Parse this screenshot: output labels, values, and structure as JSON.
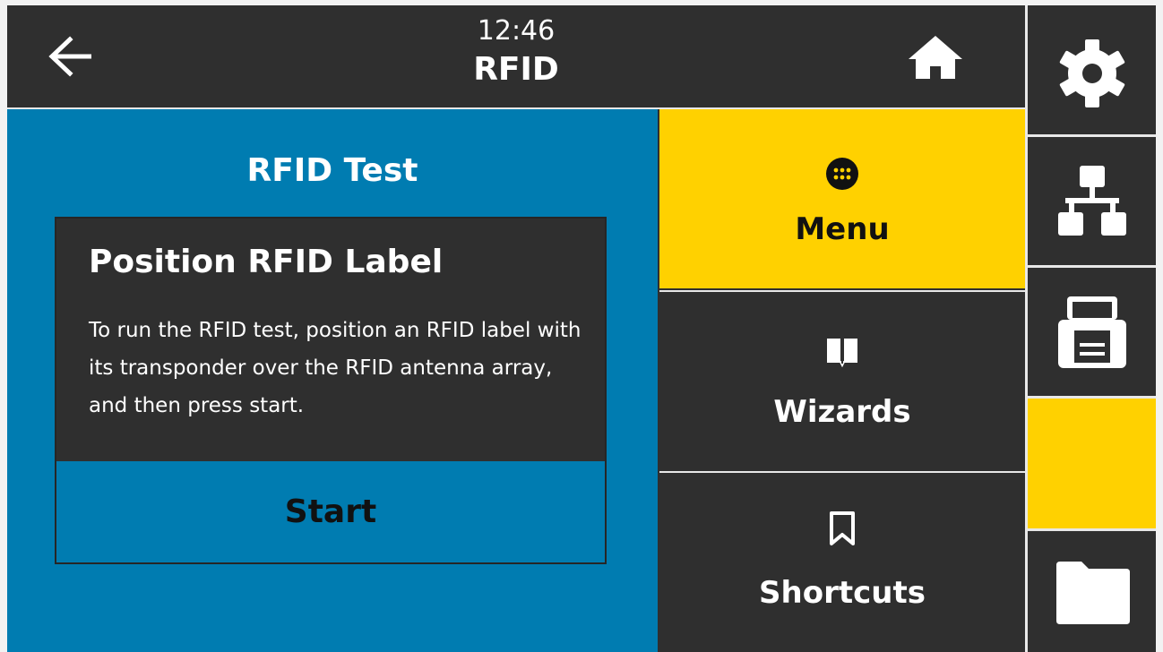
{
  "header": {
    "time": "12:46",
    "title": "RFID",
    "back_icon": "arrow-left-icon",
    "home_icon": "home-icon"
  },
  "main": {
    "title": "RFID Test",
    "dialog": {
      "heading": "Position RFID Label",
      "text": "To run the RFID test, position an RFID label with its transponder over the RFID antenna array, and then press start.",
      "start_label": "Start"
    }
  },
  "nav": {
    "menu": {
      "label": "Menu",
      "icon": "grid-dots-icon",
      "active": true
    },
    "wizards": {
      "label": "Wizards",
      "icon": "book-icon"
    },
    "shortcuts": {
      "label": "Shortcuts",
      "icon": "bookmark-icon"
    }
  },
  "rail": {
    "settings_icon": "gear-icon",
    "network_icon": "network-icon",
    "printer_icon": "printer-icon",
    "folder_icon": "folder-icon"
  },
  "colors": {
    "accent_yellow": "#ffd100",
    "panel_blue": "#007cb1",
    "dark_bg": "#2f2f2f"
  }
}
